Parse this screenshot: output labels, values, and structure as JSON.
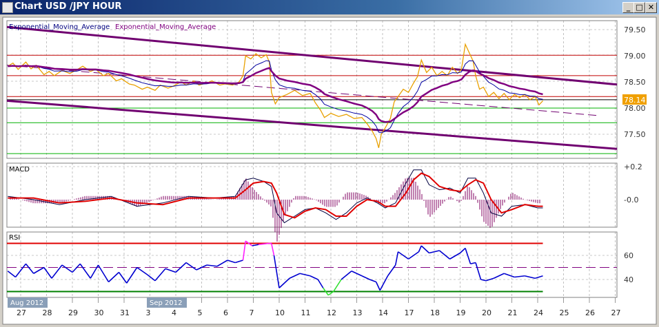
{
  "window": {
    "title": "Chart USD /JPY  HOUR",
    "minimize_label": "_",
    "maximize_label": "□",
    "close_label": "✕"
  },
  "main_panel": {
    "legend_1": "Exponential_Moving_Average",
    "legend_2": "Exponential_Moving_Average",
    "price_ticks": [
      "79.50",
      "79.00",
      "78.50",
      "78.00",
      "77.50"
    ],
    "current_price": "78.14",
    "colors": {
      "price": "#e8a000",
      "ema_fast": "#0000a0",
      "ema_slow": "#800080",
      "trend": "#700070",
      "resistance": "#c00000",
      "support": "#00b000",
      "current": "#f0a000"
    }
  },
  "macd_panel": {
    "label": "MACD",
    "ticks": [
      "+0.2",
      "-0.0"
    ]
  },
  "rsi_panel": {
    "label": "RSI",
    "ticks": [
      "60",
      "40"
    ]
  },
  "x_axis": {
    "months": [
      "Aug 2012",
      "Sep 2012"
    ],
    "dates": [
      "27",
      "28",
      "29",
      "30",
      "31",
      "3",
      "4",
      "5",
      "6",
      "7",
      "10",
      "11",
      "12",
      "13",
      "14",
      "17",
      "18",
      "19",
      "20",
      "21",
      "24",
      "25",
      "26",
      "27"
    ]
  },
  "chart_data": [
    {
      "type": "line",
      "title": "Chart USD /JPY  HOUR",
      "x_unit": "trading-day index (0 = Aug 27)",
      "ylim": [
        77.05,
        79.7
      ],
      "yticks": [
        77.5,
        78.0,
        78.5,
        79.0,
        79.5
      ],
      "series": [
        {
          "name": "price",
          "points": [
            [
              -0.5,
              78.8
            ],
            [
              -0.3,
              78.86
            ],
            [
              -0.1,
              78.74
            ],
            [
              0.2,
              78.88
            ],
            [
              0.4,
              78.75
            ],
            [
              0.6,
              78.82
            ],
            [
              0.9,
              78.64
            ],
            [
              1.1,
              78.7
            ],
            [
              1.3,
              78.62
            ],
            [
              1.6,
              78.72
            ],
            [
              1.9,
              78.66
            ],
            [
              2.2,
              78.74
            ],
            [
              2.4,
              78.8
            ],
            [
              2.7,
              78.7
            ],
            [
              2.9,
              78.74
            ],
            [
              3.2,
              78.62
            ],
            [
              3.4,
              78.66
            ],
            [
              3.7,
              78.52
            ],
            [
              3.9,
              78.56
            ],
            [
              4.2,
              78.46
            ],
            [
              4.4,
              78.44
            ],
            [
              4.7,
              78.36
            ],
            [
              4.9,
              78.4
            ],
            [
              5.2,
              78.34
            ],
            [
              5.4,
              78.44
            ],
            [
              5.7,
              78.38
            ],
            [
              5.9,
              78.42
            ],
            [
              6.2,
              78.5
            ],
            [
              6.4,
              78.44
            ],
            [
              6.7,
              78.52
            ],
            [
              6.9,
              78.44
            ],
            [
              7.2,
              78.48
            ],
            [
              7.4,
              78.52
            ],
            [
              7.7,
              78.44
            ],
            [
              7.9,
              78.46
            ],
            [
              8.2,
              78.44
            ],
            [
              8.45,
              78.5
            ],
            [
              8.6,
              78.62
            ],
            [
              8.7,
              79.0
            ],
            [
              8.9,
              78.94
            ],
            [
              9.1,
              79.04
            ],
            [
              9.3,
              78.96
            ],
            [
              9.5,
              79.02
            ],
            [
              9.62,
              78.88
            ],
            [
              9.7,
              78.3
            ],
            [
              9.85,
              78.08
            ],
            [
              10.0,
              78.2
            ],
            [
              10.3,
              78.26
            ],
            [
              10.6,
              78.34
            ],
            [
              10.9,
              78.24
            ],
            [
              11.2,
              78.28
            ],
            [
              11.4,
              78.1
            ],
            [
              11.6,
              77.96
            ],
            [
              11.75,
              77.82
            ],
            [
              12.0,
              77.9
            ],
            [
              12.3,
              77.84
            ],
            [
              12.6,
              77.88
            ],
            [
              12.9,
              77.8
            ],
            [
              13.2,
              77.82
            ],
            [
              13.4,
              77.7
            ],
            [
              13.6,
              77.56
            ],
            [
              13.75,
              77.42
            ],
            [
              13.85,
              77.24
            ],
            [
              13.95,
              77.5
            ],
            [
              14.1,
              77.62
            ],
            [
              14.3,
              77.8
            ],
            [
              14.45,
              78.12
            ],
            [
              14.6,
              78.22
            ],
            [
              14.8,
              78.36
            ],
            [
              15.0,
              78.3
            ],
            [
              15.2,
              78.48
            ],
            [
              15.35,
              78.6
            ],
            [
              15.5,
              78.92
            ],
            [
              15.7,
              78.68
            ],
            [
              15.9,
              78.78
            ],
            [
              16.1,
              78.62
            ],
            [
              16.3,
              78.7
            ],
            [
              16.5,
              78.62
            ],
            [
              16.7,
              78.78
            ],
            [
              16.9,
              78.66
            ],
            [
              17.05,
              78.74
            ],
            [
              17.2,
              79.22
            ],
            [
              17.35,
              79.06
            ],
            [
              17.5,
              78.9
            ],
            [
              17.6,
              78.62
            ],
            [
              17.75,
              78.36
            ],
            [
              17.9,
              78.4
            ],
            [
              18.1,
              78.22
            ],
            [
              18.3,
              78.3
            ],
            [
              18.5,
              78.18
            ],
            [
              18.7,
              78.28
            ],
            [
              18.9,
              78.16
            ],
            [
              19.1,
              78.26
            ],
            [
              19.3,
              78.2
            ],
            [
              19.5,
              78.26
            ],
            [
              19.7,
              78.16
            ],
            [
              19.9,
              78.22
            ],
            [
              20.05,
              78.06
            ],
            [
              20.2,
              78.14
            ]
          ]
        },
        {
          "name": "Exponential_Moving_Average (fast)",
          "derived_from": "price",
          "period_points": 6
        },
        {
          "name": "Exponential_Moving_Average (slow)",
          "derived_from": "price",
          "period_points": 14
        }
      ],
      "horizontal_lines": [
        {
          "kind": "resistance",
          "value": 79.01
        },
        {
          "kind": "resistance",
          "value": 78.62
        },
        {
          "kind": "resistance",
          "value": 78.22
        },
        {
          "kind": "current",
          "value": 78.16
        },
        {
          "kind": "support",
          "value": 78.0
        },
        {
          "kind": "support",
          "value": 77.72
        },
        {
          "kind": "support",
          "value": 77.13
        }
      ],
      "trend_lines": [
        {
          "kind": "upper-channel",
          "from": [
            -0.53,
            79.55
          ],
          "to": [
            23.07,
            78.45
          ]
        },
        {
          "kind": "lower-channel",
          "from": [
            -0.53,
            78.14
          ],
          "to": [
            23.07,
            77.22
          ]
        },
        {
          "kind": "mid-dashed",
          "from": [
            -0.53,
            78.82
          ],
          "to": [
            22.27,
            77.86
          ]
        }
      ]
    },
    {
      "type": "line",
      "title": "MACD",
      "ylim": [
        -0.2,
        0.22
      ],
      "x": [
        -0.5,
        0.5,
        1.5,
        2.5,
        3.5,
        4.5,
        5.5,
        6.5,
        7.5,
        8.3,
        8.7,
        9.0,
        9.4,
        9.7,
        9.9,
        10.2,
        10.6,
        11.0,
        11.4,
        11.8,
        12.2,
        12.6,
        13.0,
        13.4,
        13.8,
        14.1,
        14.5,
        14.9,
        15.2,
        15.5,
        15.8,
        16.2,
        16.6,
        17.0,
        17.3,
        17.6,
        17.9,
        18.2,
        18.6,
        19.0,
        19.5,
        20.0,
        20.2
      ],
      "series": [
        {
          "name": "macd",
          "values": [
            0.02,
            0.0,
            -0.03,
            0.0,
            0.02,
            -0.04,
            -0.02,
            0.02,
            0.01,
            0.02,
            0.12,
            0.13,
            0.11,
            0.08,
            -0.08,
            -0.14,
            -0.1,
            -0.06,
            -0.05,
            -0.08,
            -0.12,
            -0.08,
            -0.02,
            0.01,
            -0.02,
            -0.05,
            -0.02,
            0.1,
            0.18,
            0.18,
            0.09,
            0.06,
            0.07,
            0.04,
            0.13,
            0.13,
            0.04,
            -0.08,
            -0.1,
            -0.04,
            -0.03,
            -0.05,
            -0.05
          ]
        },
        {
          "name": "signal",
          "values": [
            0.01,
            0.01,
            -0.02,
            -0.01,
            0.01,
            -0.02,
            -0.03,
            0.01,
            0.01,
            0.01,
            0.06,
            0.1,
            0.11,
            0.1,
            0.04,
            -0.09,
            -0.11,
            -0.07,
            -0.05,
            -0.06,
            -0.1,
            -0.1,
            -0.04,
            0.0,
            -0.01,
            -0.04,
            -0.04,
            0.04,
            0.12,
            0.16,
            0.14,
            0.08,
            0.06,
            0.05,
            0.09,
            0.12,
            0.1,
            0.0,
            -0.08,
            -0.06,
            -0.03,
            -0.04,
            -0.04
          ]
        }
      ],
      "yticks": [
        0.2,
        0.0
      ]
    },
    {
      "type": "line",
      "title": "RSI",
      "ylim": [
        24,
        78
      ],
      "levels": {
        "overbought": 70,
        "mid": 50,
        "oversold": 30
      },
      "yticks": [
        60,
        40
      ],
      "x": [
        -0.5,
        -0.2,
        0.2,
        0.5,
        0.9,
        1.2,
        1.6,
        2.0,
        2.3,
        2.7,
        3.0,
        3.4,
        3.8,
        4.1,
        4.5,
        4.9,
        5.2,
        5.6,
        6.0,
        6.4,
        6.8,
        7.2,
        7.6,
        8.0,
        8.3,
        8.6,
        8.7,
        8.95,
        9.2,
        9.6,
        9.7,
        9.8,
        10.0,
        10.4,
        10.8,
        11.2,
        11.5,
        11.7,
        11.9,
        12.1,
        12.4,
        12.8,
        13.2,
        13.5,
        13.75,
        13.9,
        14.2,
        14.5,
        14.6,
        15.0,
        15.4,
        15.5,
        15.8,
        16.2,
        16.6,
        17.0,
        17.2,
        17.4,
        17.6,
        17.8,
        18.0,
        18.3,
        18.7,
        19.1,
        19.5,
        19.9,
        20.2
      ],
      "values": [
        47,
        42,
        53,
        45,
        50,
        41,
        52,
        46,
        53,
        41,
        52,
        38,
        46,
        37,
        50,
        44,
        39,
        49,
        46,
        54,
        48,
        52,
        51,
        56,
        54,
        56,
        72,
        68,
        69,
        70,
        70,
        60,
        33,
        41,
        45,
        43,
        40,
        33,
        27,
        30,
        40,
        47,
        43,
        40,
        38,
        31,
        43,
        52,
        63,
        57,
        63,
        68,
        62,
        64,
        57,
        62,
        66,
        53,
        54,
        40,
        39,
        41,
        45,
        42,
        43,
        41,
        43
      ]
    }
  ]
}
